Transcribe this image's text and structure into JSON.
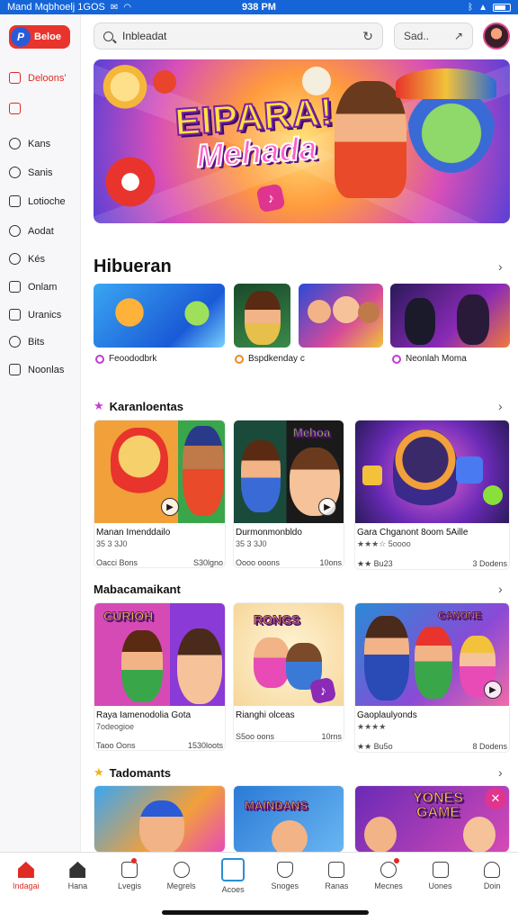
{
  "status_bar": {
    "left_text": "Mand Mqbhoelj 1GOS",
    "time": "938 PM",
    "battery_icon": "battery-icon",
    "wifi_icon": "wifi-icon",
    "bluetooth_icon": "bluetooth-icon"
  },
  "app": {
    "logo_letter": "P",
    "logo_label": "Beloe"
  },
  "sidebar": {
    "items": [
      {
        "label": "Deloons'",
        "icon": "home-icon",
        "active": true
      },
      {
        "label": "",
        "icon": "edit-icon",
        "active": true
      },
      {
        "label": "Kans",
        "icon": "compass-icon",
        "active": false
      },
      {
        "label": "Sanis",
        "icon": "user-icon",
        "active": false
      },
      {
        "label": "Lotioche",
        "icon": "document-icon",
        "active": false
      },
      {
        "label": "Aodat",
        "icon": "shield-icon",
        "active": false
      },
      {
        "label": "Kés",
        "icon": "circle-icon",
        "active": false
      },
      {
        "label": "Onlam",
        "icon": "bag-icon",
        "active": false
      },
      {
        "label": "Uranics",
        "icon": "list-icon",
        "active": false
      },
      {
        "label": "Bits",
        "icon": "globe-icon",
        "active": false
      },
      {
        "label": "Noonlas",
        "icon": "square-icon",
        "active": false
      }
    ]
  },
  "search": {
    "placeholder": "Inbleadat",
    "value": "Inbleadat",
    "sort_label": "Sad.."
  },
  "hero": {
    "title_line1": "EIPARA!",
    "title_line2": "Mehada"
  },
  "sections": {
    "hiburan": {
      "title": "Hibueran",
      "items": [
        {
          "label": "Feoododbrk",
          "dot_color": "#c43ad6"
        },
        {
          "label": "Bspdkenday c",
          "dot_color": "#f08a1e"
        },
        {
          "label": "Neonlah Moma",
          "dot_color": "#c43ad6"
        }
      ]
    },
    "karanloentas": {
      "title": "Karanloentas",
      "cards": [
        {
          "title": "Manan Imenddailo",
          "sub": "35 3 3J0",
          "foot_left": "Oacci Bons",
          "foot_right": "S30lgno",
          "thumb_text": ""
        },
        {
          "title": "Durmonmonbldo",
          "sub": "35 3 3J0",
          "foot_left": "Oooo ooons",
          "foot_right": "10ons",
          "thumb_text": "Mehoa"
        },
        {
          "title": "Gara Chganont 8oom 5Aille",
          "sub": "★★★☆ 5oooo",
          "foot_left": "★★ Bu23",
          "foot_right": "3 Dodens",
          "thumb_text": ""
        }
      ]
    },
    "mabacamaikant": {
      "title": "Mabacamaikant",
      "cards": [
        {
          "title": "Raya Iamenodolia Gota",
          "sub": "7odeogioe",
          "foot_left": "Taoo Oons",
          "foot_right": "1530loots",
          "thumb_text": "CURIOH"
        },
        {
          "title": "Rianghi olceas",
          "sub": "",
          "foot_left": "S5oo oons",
          "foot_right": "10rns",
          "thumb_text": "RONGS"
        },
        {
          "title": "Gaoplaulyonds",
          "sub": "★★★★",
          "foot_left": "★★ Bu5o",
          "foot_right": "8 Dodens",
          "thumb_text": "GANONE"
        }
      ]
    },
    "tadomants": {
      "title": "Tadomants",
      "thumbs": [
        {
          "thumb_text": ""
        },
        {
          "thumb_text": "MAINDANS"
        },
        {
          "thumb_text": "YONES GAME"
        }
      ]
    }
  },
  "bottom_nav": [
    {
      "label": "Indagai",
      "icon": "home-icon",
      "active": true
    },
    {
      "label": "Hana",
      "icon": "house-icon",
      "active": false
    },
    {
      "label": "Lvegis",
      "icon": "calendar-icon",
      "active": false
    },
    {
      "label": "Megrels",
      "icon": "chat-icon",
      "active": false
    },
    {
      "label": "Acoes",
      "icon": "gamepad-icon",
      "active": false
    },
    {
      "label": "Snoges",
      "icon": "shield-icon",
      "active": false
    },
    {
      "label": "Ranas",
      "icon": "flag-icon",
      "active": false
    },
    {
      "label": "Mecnes",
      "icon": "gear-icon",
      "active": false
    },
    {
      "label": "Uones",
      "icon": "image-icon",
      "active": false
    },
    {
      "label": "Doin",
      "icon": "person-icon",
      "active": false
    }
  ],
  "colors": {
    "accent": "#e02a24",
    "status_bar": "#1565d8",
    "logo_blue": "#2a5bd7"
  }
}
